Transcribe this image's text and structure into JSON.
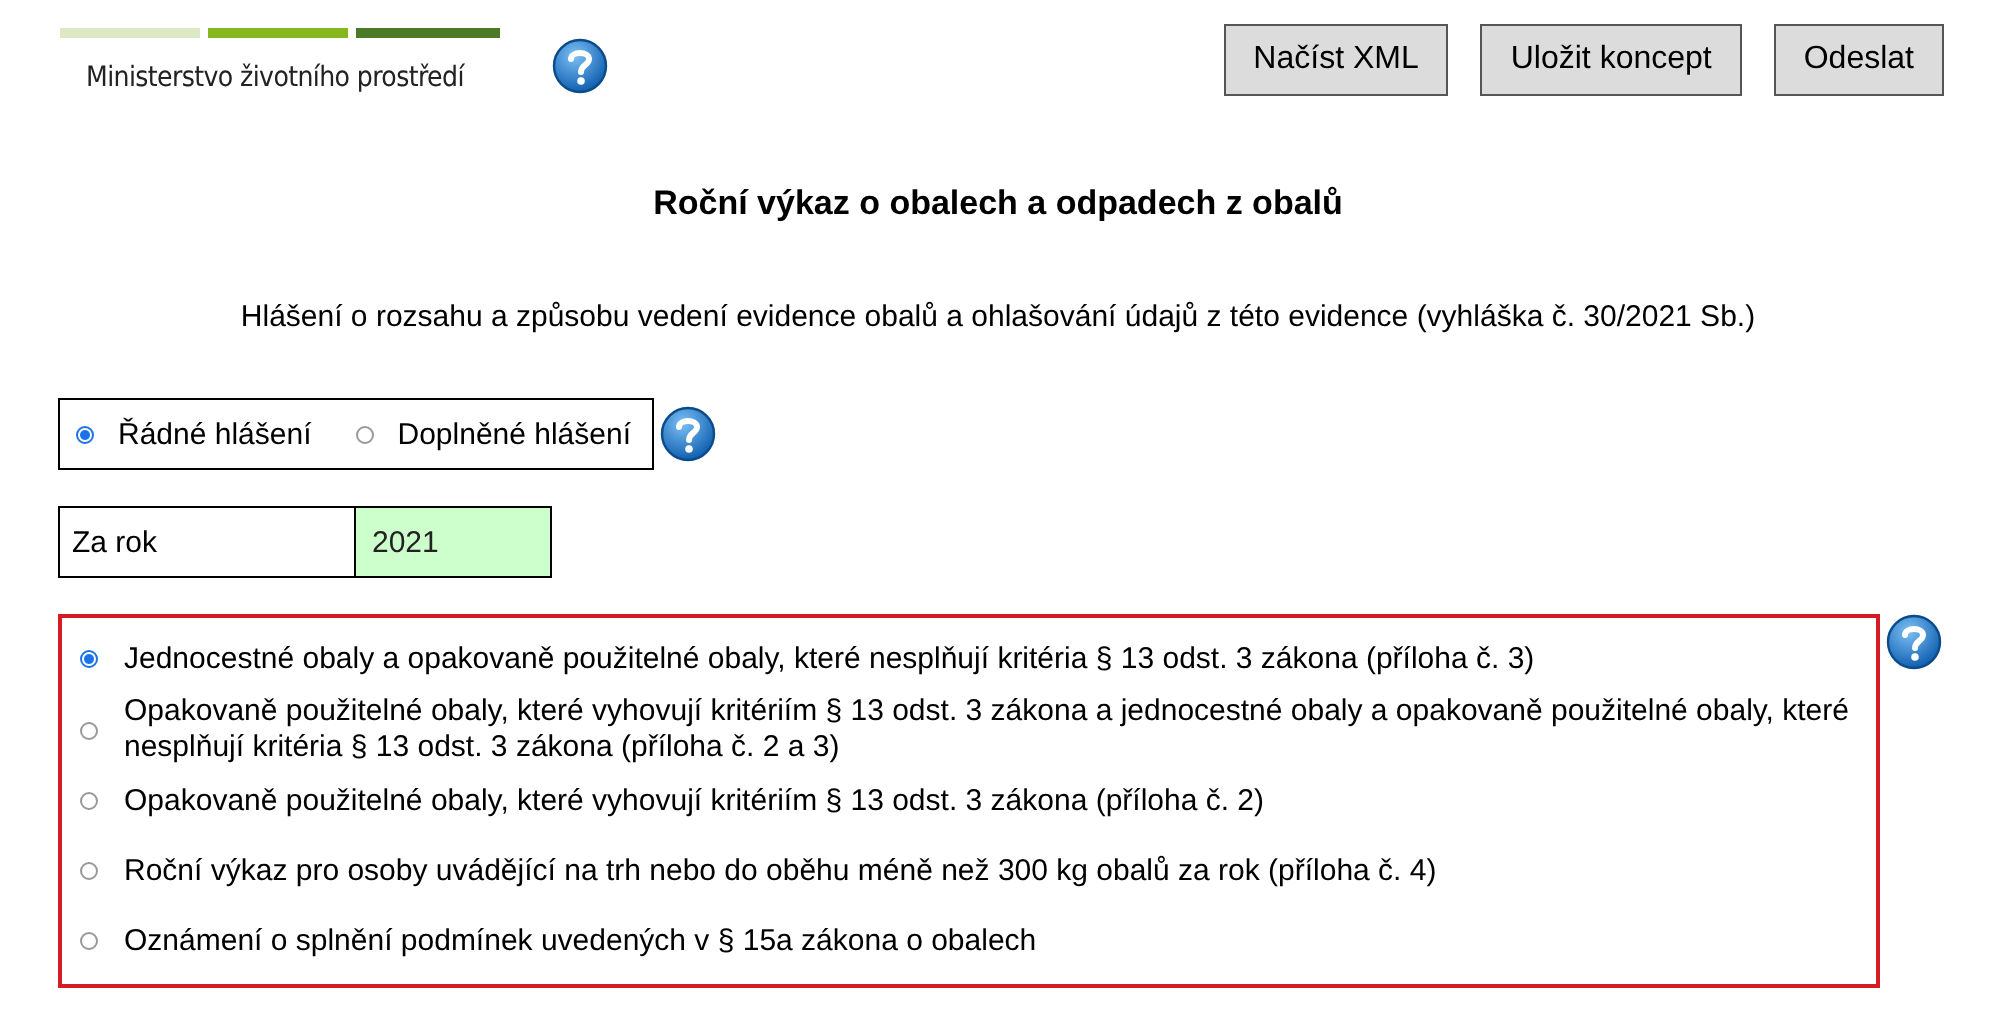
{
  "header": {
    "logo_text": "Ministerstvo životního prostředí",
    "buttons": [
      "Načíst XML",
      "Uložit koncept",
      "Odeslat"
    ]
  },
  "title": "Roční výkaz o obalech a odpadech z obalů",
  "subtitle": "Hlášení o rozsahu a způsobu vedení evidence obalů a ohlašování údajů z této evidence (vyhláška č. 30/2021 Sb.)",
  "report_type": [
    {
      "label": "Řádné hlášení",
      "selected": true
    },
    {
      "label": "Doplněné hlášení",
      "selected": false
    }
  ],
  "year": {
    "label": "Za rok",
    "value": "2021"
  },
  "annex_options": [
    {
      "label": "Jednocestné obaly a opakovaně použitelné obaly, které nesplňují kritéria § 13 odst. 3 zákona (příloha č. 3)",
      "selected": true
    },
    {
      "label": "Opakovaně použitelné obaly, které vyhovují kritériím § 13 odst. 3 zákona a jednocestné obaly a opakovaně použitelné obaly, které nesplňují kritéria § 13 odst. 3 zákona (příloha č. 2 a 3)",
      "selected": false
    },
    {
      "label": "Opakovaně použitelné obaly, které vyhovují kritériím § 13 odst. 3 zákona (příloha č. 2)",
      "selected": false
    },
    {
      "label": "Roční výkaz pro osoby uvádějící na trh nebo do oběhu méně než 300 kg obalů za rok (příloha č. 4)",
      "selected": false
    },
    {
      "label": "Oznámení o splnění podmínek uvedených v § 15a zákona o obalech",
      "selected": false
    }
  ]
}
